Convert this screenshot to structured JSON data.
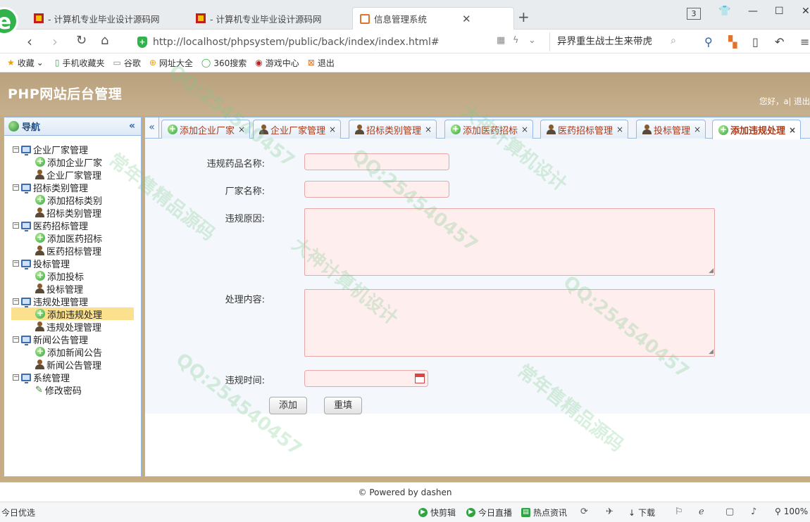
{
  "browser": {
    "tabs": [
      {
        "title": "- 计算机专业毕业设计源码网"
      },
      {
        "title": "- 计算机专业毕业设计源码网"
      },
      {
        "title": "信息管理系统"
      }
    ],
    "tab_count": "3",
    "url": "http://localhost/phpsystem/public/back/index/index.html#",
    "search_text": "异界重生战士生来带虎",
    "bookmarks": [
      {
        "label": "收藏"
      },
      {
        "label": "手机收藏夹"
      },
      {
        "label": "谷歌"
      },
      {
        "label": "网址大全"
      },
      {
        "label": "360搜索"
      },
      {
        "label": "游戏中心"
      },
      {
        "label": "退出"
      }
    ]
  },
  "header": {
    "title": "PHP网站后台管理",
    "user_text": "您好，a| 退出"
  },
  "sidebar": {
    "title": "导航",
    "groups": [
      {
        "label": "企业厂家管理",
        "items": [
          "添加企业厂家",
          "企业厂家管理"
        ]
      },
      {
        "label": "招标类别管理",
        "items": [
          "添加招标类别",
          "招标类别管理"
        ]
      },
      {
        "label": "医药招标管理",
        "items": [
          "添加医药招标",
          "医药招标管理"
        ]
      },
      {
        "label": "投标管理",
        "items": [
          "添加投标",
          "投标管理"
        ]
      },
      {
        "label": "违规处理管理",
        "items": [
          "添加违规处理",
          "违规处理管理"
        ]
      },
      {
        "label": "新闻公告管理",
        "items": [
          "添加新闻公告",
          "新闻公告管理"
        ]
      },
      {
        "label": "系统管理",
        "items": [
          "修改密码"
        ]
      }
    ]
  },
  "tabs": [
    {
      "label": "添加企业厂家"
    },
    {
      "label": "企业厂家管理"
    },
    {
      "label": "招标类别管理"
    },
    {
      "label": "添加医药招标"
    },
    {
      "label": "医药招标管理"
    },
    {
      "label": "投标管理"
    },
    {
      "label": "添加违规处理"
    }
  ],
  "form": {
    "drug_name_label": "违规药品名称:",
    "manufacturer_label": "厂家名称:",
    "reason_label": "违规原因:",
    "content_label": "处理内容:",
    "time_label": "违规时间:",
    "submit_label": "添加",
    "reset_label": "重填"
  },
  "footer": {
    "text": "© Powered by dashen"
  },
  "statusbar": {
    "left": "今日优选",
    "items": [
      "快剪辑",
      "今日直播",
      "热点资讯"
    ],
    "download": "下载",
    "zoom": "100%"
  },
  "watermarks": [
    "QQ:254540457",
    "大神计算机设计",
    "常年售精品源码"
  ],
  "colors": {
    "header_bg": "#c3ab86",
    "tab_text": "#a93a1a",
    "selected_bg": "#fbe08d",
    "input_bg": "#ffeeee"
  }
}
